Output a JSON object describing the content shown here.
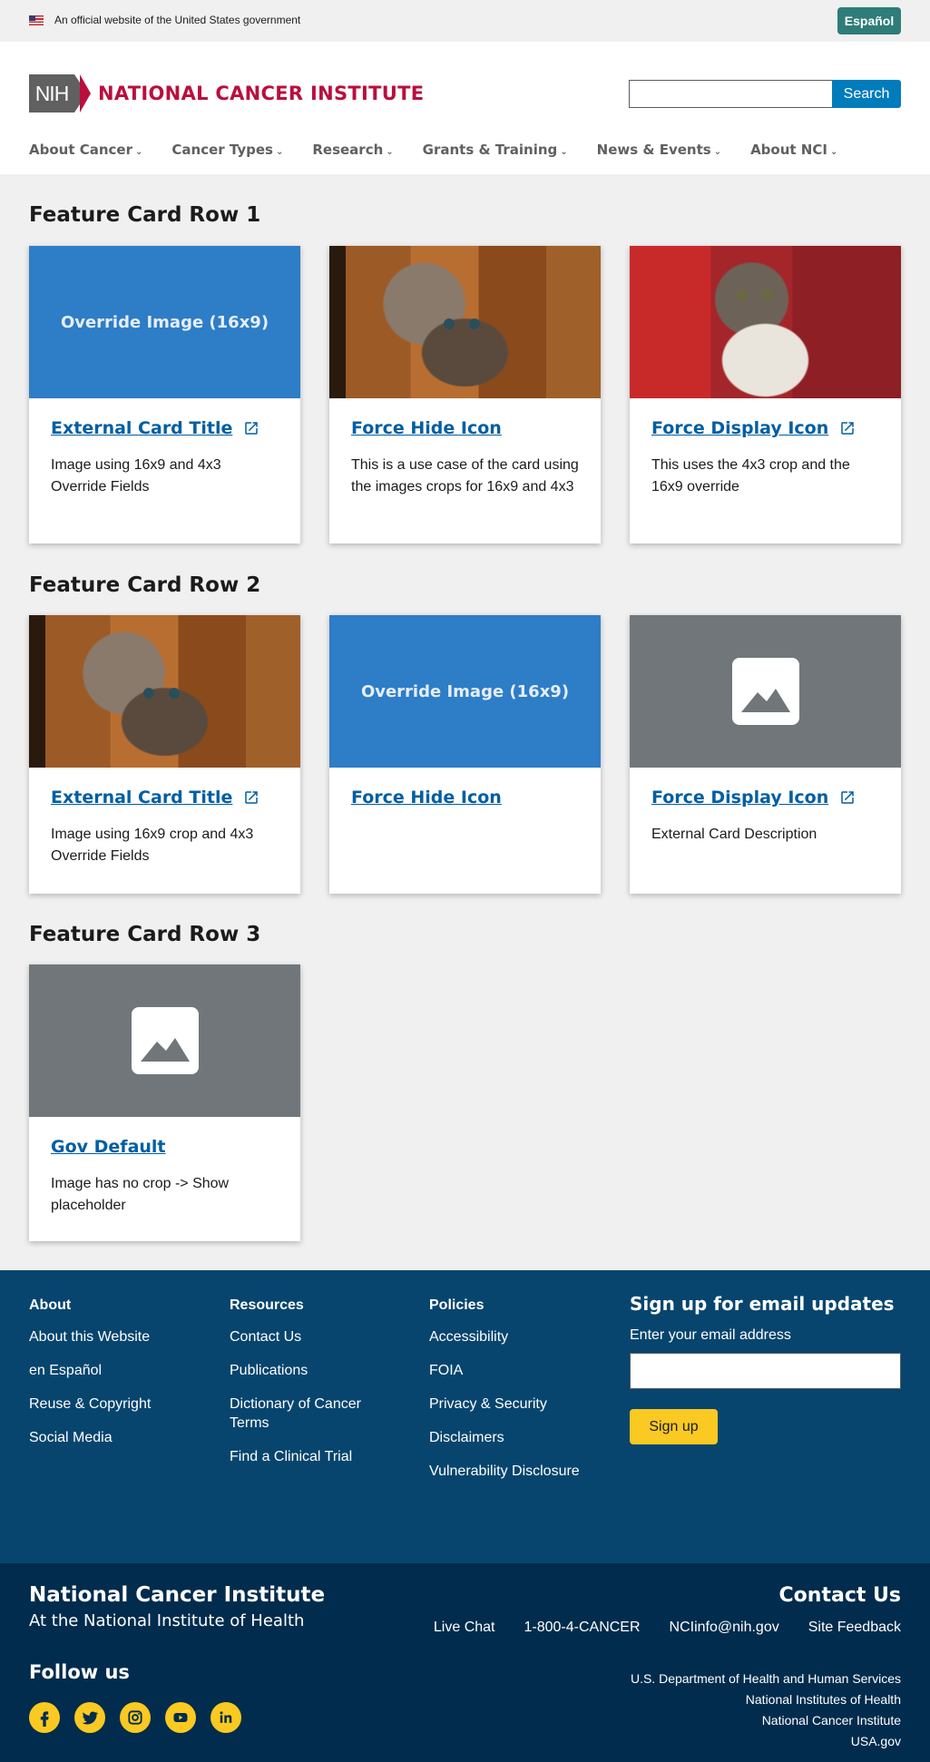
{
  "gov_banner": {
    "text": "An official website of the United States government",
    "language_button": "Español"
  },
  "header": {
    "logo_mark": "NIH",
    "logo_name": "NATIONAL CANCER INSTITUTE",
    "search_placeholder": "",
    "search_button": "Search",
    "nav": [
      "About Cancer",
      "Cancer Types",
      "Research",
      "Grants & Training",
      "News & Events",
      "About NCI"
    ]
  },
  "rows": [
    {
      "heading": "Feature Card Row 1",
      "cards": [
        {
          "image": "Override Image (16x9)",
          "title": "External Card Title",
          "external": true,
          "desc": "Image using 16x9 and 4x3 Override Fields"
        },
        {
          "image": "kitten-photo",
          "title": "Force Hide Icon",
          "external": false,
          "desc": "This is a use case of the card using the images crops for 16x9 and 4x3"
        },
        {
          "image": "kitten-photo",
          "title": "Force Display Icon",
          "external": true,
          "desc": "This uses the 4x3 crop and the 16x9 override"
        }
      ]
    },
    {
      "heading": "Feature Card Row 2",
      "cards": [
        {
          "image": "kitten-photo",
          "title": "External Card Title",
          "external": true,
          "desc": "Image using 16x9 crop and 4x3 Override Fields"
        },
        {
          "image": "Override Image (16x9)",
          "title": "Force Hide Icon",
          "external": false,
          "desc": ""
        },
        {
          "image": "placeholder-icon",
          "title": "Force Display Icon",
          "external": true,
          "desc": "External Card Description"
        }
      ]
    },
    {
      "heading": "Feature Card Row 3",
      "cards": [
        {
          "image": "placeholder-icon",
          "title": "Gov Default",
          "external": false,
          "desc": "Image has no crop -> Show placeholder"
        }
      ]
    }
  ],
  "footer": {
    "columns": [
      {
        "title": "About",
        "links": [
          "About this Website",
          "en Español",
          "Reuse & Copyright",
          "Social Media"
        ]
      },
      {
        "title": "Resources",
        "links": [
          "Contact Us",
          "Publications",
          "Dictionary of Cancer Terms",
          "Find a Clinical Trial"
        ]
      },
      {
        "title": "Policies",
        "links": [
          "Accessibility",
          "FOIA",
          "Privacy & Security",
          "Disclaimers",
          "Vulnerability Disclosure"
        ]
      }
    ],
    "signup": {
      "title": "Sign up for email updates",
      "label": "Enter your email address",
      "button": "Sign up"
    }
  },
  "bottom_footer": {
    "name": "National Cancer Institute",
    "sub": "At the National Institute of Health",
    "contact_title": "Contact Us",
    "contact_links": [
      "Live Chat",
      "1-800-4-CANCER",
      "NCIinfo@nih.gov",
      "Site Feedback"
    ],
    "follow_title": "Follow us",
    "social": [
      "facebook-icon",
      "twitter-icon",
      "instagram-icon",
      "youtube-icon",
      "linkedin-icon"
    ],
    "agencies": [
      "U.S. Department of Health and Human Services",
      "National Institutes of Health",
      "National Cancer Institute",
      "USA.gov"
    ]
  },
  "colors": {
    "nci_red": "#bb0e3d",
    "link_blue": "#005ea2",
    "footer_blue": "#07456e",
    "footer_dark": "#012c4d",
    "accent_yellow": "#fac922",
    "teal_button": "#2e7d78"
  }
}
